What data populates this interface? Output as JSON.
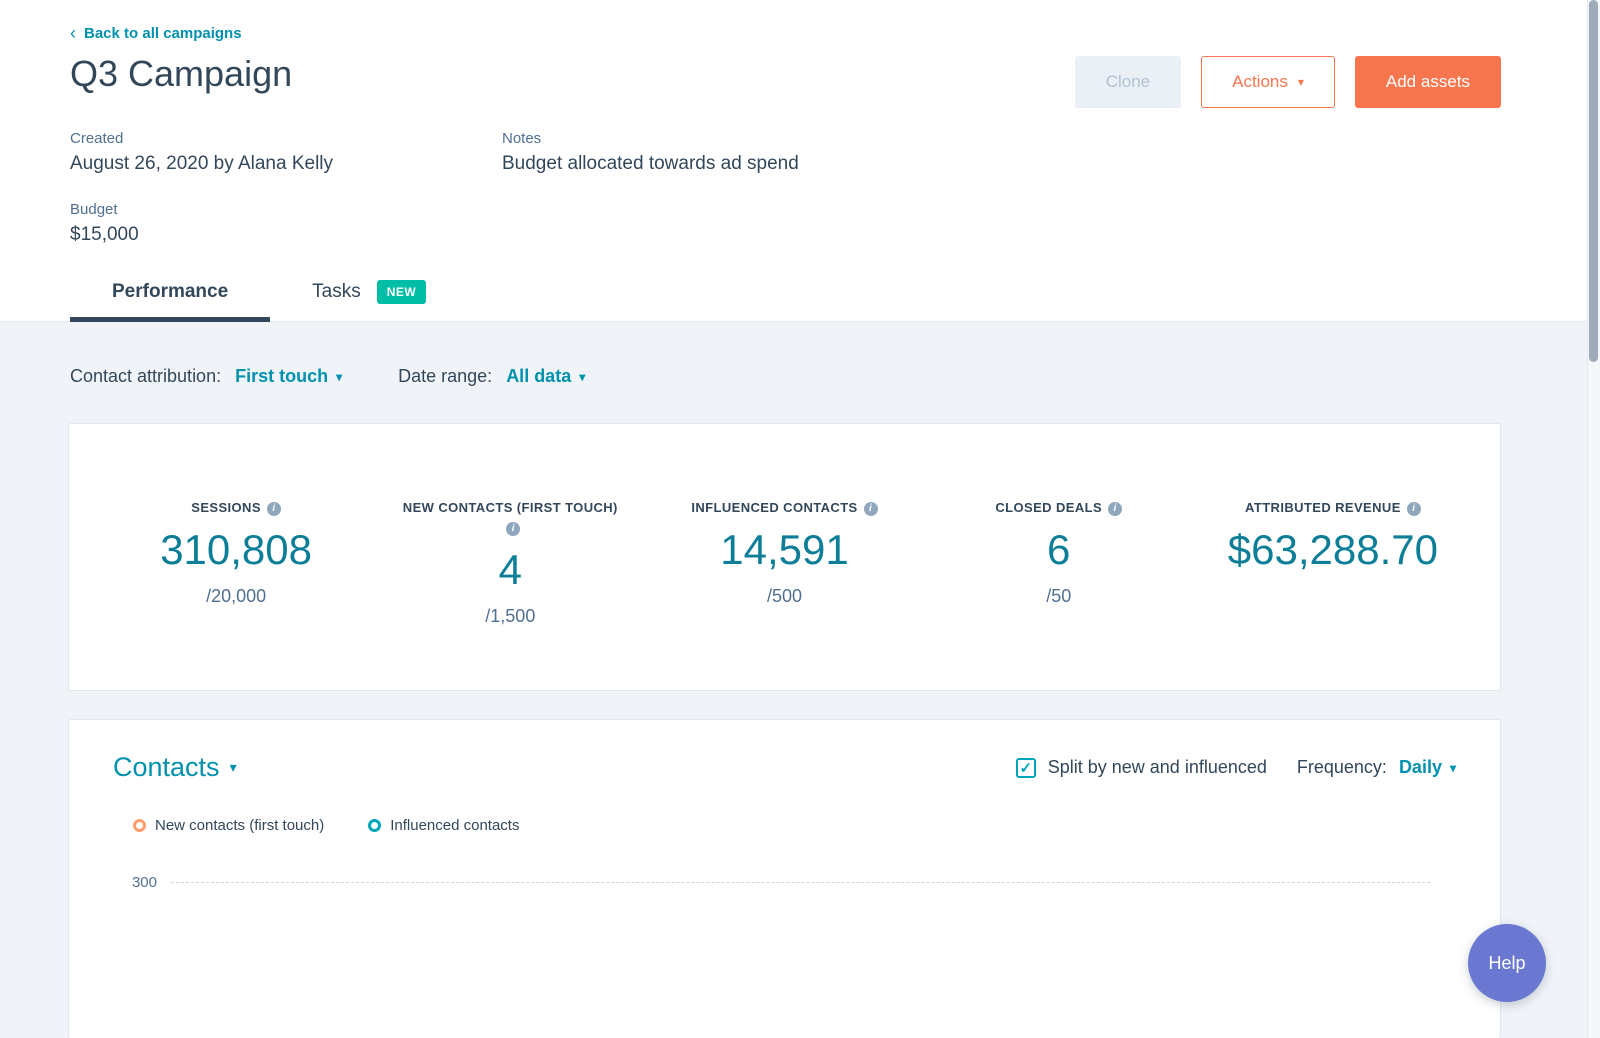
{
  "header": {
    "back_link": "Back to all campaigns",
    "title": "Q3 Campaign",
    "buttons": {
      "clone": "Clone",
      "actions": "Actions",
      "add_assets": "Add assets"
    },
    "meta": {
      "created_label": "Created",
      "created_value": "August 26, 2020 by Alana Kelly",
      "notes_label": "Notes",
      "notes_value": "Budget allocated towards ad spend",
      "budget_label": "Budget",
      "budget_value": "$15,000"
    },
    "tabs": [
      {
        "label": "Performance",
        "active": true
      },
      {
        "label": "Tasks",
        "badge": "NEW"
      }
    ]
  },
  "filters": {
    "attribution_label": "Contact attribution:",
    "attribution_value": "First touch",
    "date_label": "Date range:",
    "date_value": "All data"
  },
  "stats": [
    {
      "label": "SESSIONS",
      "value": "310,808",
      "target": "/20,000"
    },
    {
      "label": "NEW CONTACTS (FIRST TOUCH)",
      "value": "4",
      "target": "/1,500"
    },
    {
      "label": "INFLUENCED CONTACTS",
      "value": "14,591",
      "target": "/500"
    },
    {
      "label": "CLOSED DEALS",
      "value": "6",
      "target": "/50"
    },
    {
      "label": "ATTRIBUTED REVENUE",
      "value": "$63,288.70",
      "target": ""
    }
  ],
  "contacts": {
    "title": "Contacts",
    "split_label": "Split by new and influenced",
    "split_checked": true,
    "frequency_label": "Frequency:",
    "frequency_value": "Daily",
    "legend": [
      {
        "label": "New contacts (first touch)",
        "color": "#ff9d6f"
      },
      {
        "label": "Influenced contacts",
        "color": "#00a4bd"
      }
    ],
    "y_tick": "300"
  },
  "help": {
    "label": "Help"
  },
  "colors": {
    "accent_orange": "#f8764e",
    "teal_link": "#0091ae",
    "metric_teal": "#0d7e98",
    "badge_green": "#00bda5",
    "dark_text": "#33475b",
    "muted_text": "#516f90",
    "page_bg": "#f0f4f9",
    "help_purple": "#6a78d1"
  }
}
